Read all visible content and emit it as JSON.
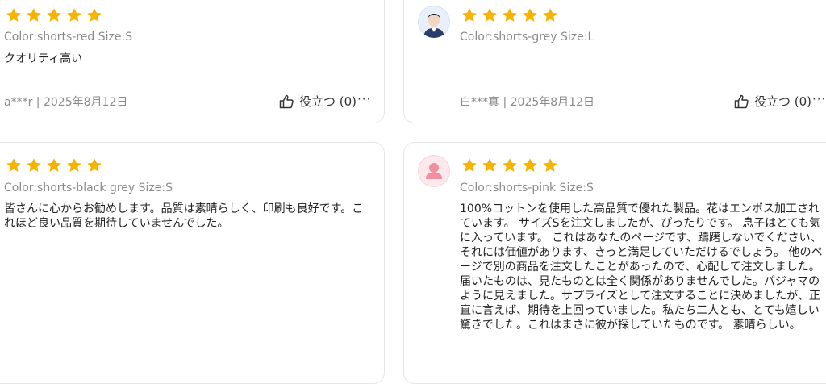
{
  "colors": {
    "star": "#f6b400",
    "muted": "#8a8a8a",
    "border": "#e6e6e6"
  },
  "reviews": [
    {
      "rating": 5,
      "variant": "Color:shorts-red Size:S",
      "text": "クオリティ高い",
      "author": "a***r",
      "date": "2025年8月12日",
      "helpful_label": "役立つ (0)",
      "more_label": "···",
      "avatar": "none"
    },
    {
      "rating": 5,
      "variant": "Color:shorts-grey Size:L",
      "text": "",
      "author": "白***真",
      "date": "2025年8月12日",
      "helpful_label": "役立つ (0)",
      "more_label": "···",
      "avatar": "male-avatar-icon"
    },
    {
      "rating": 5,
      "variant": "Color:shorts-black grey Size:S",
      "text": "皆さんに心からお勧めします。品質は素晴らしく、印刷も良好です。これほど良い品質を期待していませんでした。",
      "avatar": "none"
    },
    {
      "rating": 5,
      "variant": "Color:shorts-pink Size:S",
      "text": "100%コットンを使用した高品質で優れた製品。花はエンボス加工されています。 サイズSを注文しましたが、ぴったりです。 息子はとても気に入っています。 これはあなたのページです、躊躇しないでください、それには価値があります、きっと満足していただけるでしょう。 他のページで別の商品を注文したことがあったので、心配して注文しました。届いたものは、見たものとは全く関係がありませんでした。パジャマのように見えました。サプライズとして注文することに決めましたが、正直に言えば、期待を上回っていました。私たち二人とも、とても嬉しい驚きでした。これはまさに彼が探していたものです。 素晴らしい。",
      "avatar": "user-placeholder-icon"
    }
  ]
}
